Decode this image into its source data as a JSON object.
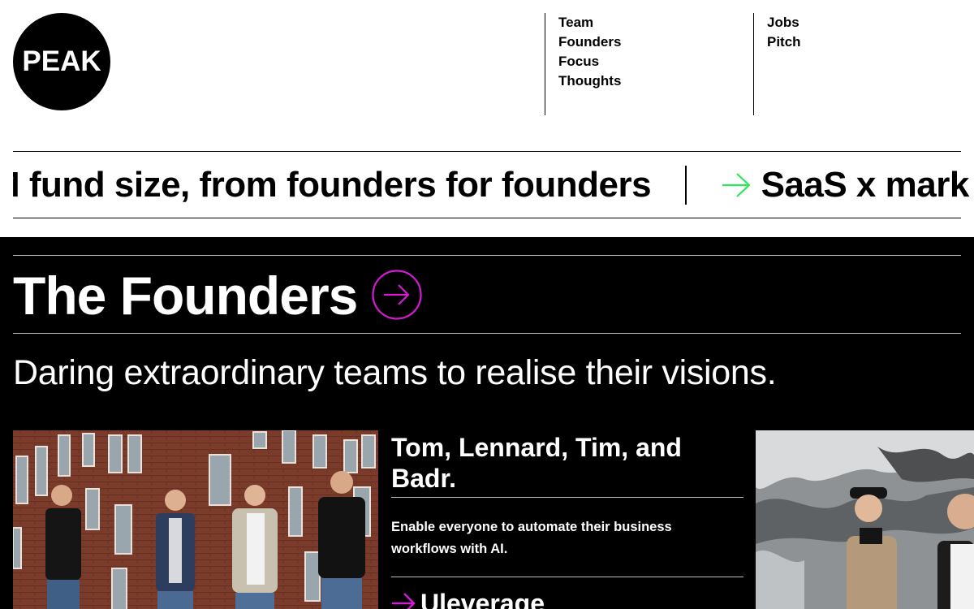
{
  "logo": {
    "text": "PEAK"
  },
  "nav": {
    "column1": [
      "Team",
      "Founders",
      "Focus",
      "Thoughts"
    ],
    "column2": [
      "Jobs",
      "Pitch"
    ]
  },
  "ticker": {
    "item1": "M fund size, from founders for founders",
    "item2": "SaaS x mark",
    "arrow_color": "#2ee65a"
  },
  "founders_section": {
    "title": "The Founders",
    "tagline": "Daring extraordinary teams to realise their visions.",
    "accent_color": "#d41bd4",
    "card": {
      "names": "Tom, Lennard, Tim, and Badr.",
      "description": "Enable everyone to automate their business workflows with AI.",
      "company": "Uleverage"
    }
  }
}
